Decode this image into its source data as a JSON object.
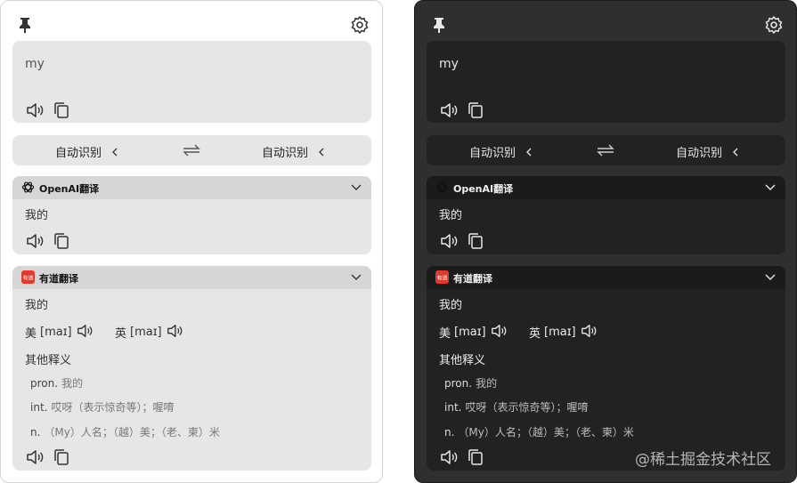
{
  "colors": {
    "light_bg": "#ffffff",
    "light_card": "#e6e6e6",
    "dark_bg": "#2f2f30",
    "dark_card": "#222224",
    "youdao_red": "#e03a2e"
  },
  "icons": [
    "pin-icon",
    "gear-icon",
    "speaker-icon",
    "copy-icon",
    "swap-icon",
    "chevron-left-icon",
    "chevron-down-icon",
    "openai-logo-icon",
    "youdao-logo-icon"
  ],
  "source": {
    "text": "my"
  },
  "lang": {
    "from": "自动识别",
    "to": "自动识别"
  },
  "openai": {
    "title": "OpenAI翻译",
    "result": "我的"
  },
  "youdao": {
    "title": "有道翻译",
    "logo_text": "有道",
    "result": "我的",
    "us_label": "美",
    "us_phonetic": "[maɪ]",
    "uk_label": "英",
    "uk_phonetic": "[maɪ]",
    "other_label": "其他释义",
    "defs": [
      {
        "pos": "pron.",
        "mean": "我的"
      },
      {
        "pos": "int.",
        "mean": "哎呀（表示惊奇等）；喔唷"
      },
      {
        "pos": "n.",
        "mean": "（My）人名；（越）美；（老、柬）米"
      }
    ]
  },
  "watermark": "@稀土掘金技术社区"
}
